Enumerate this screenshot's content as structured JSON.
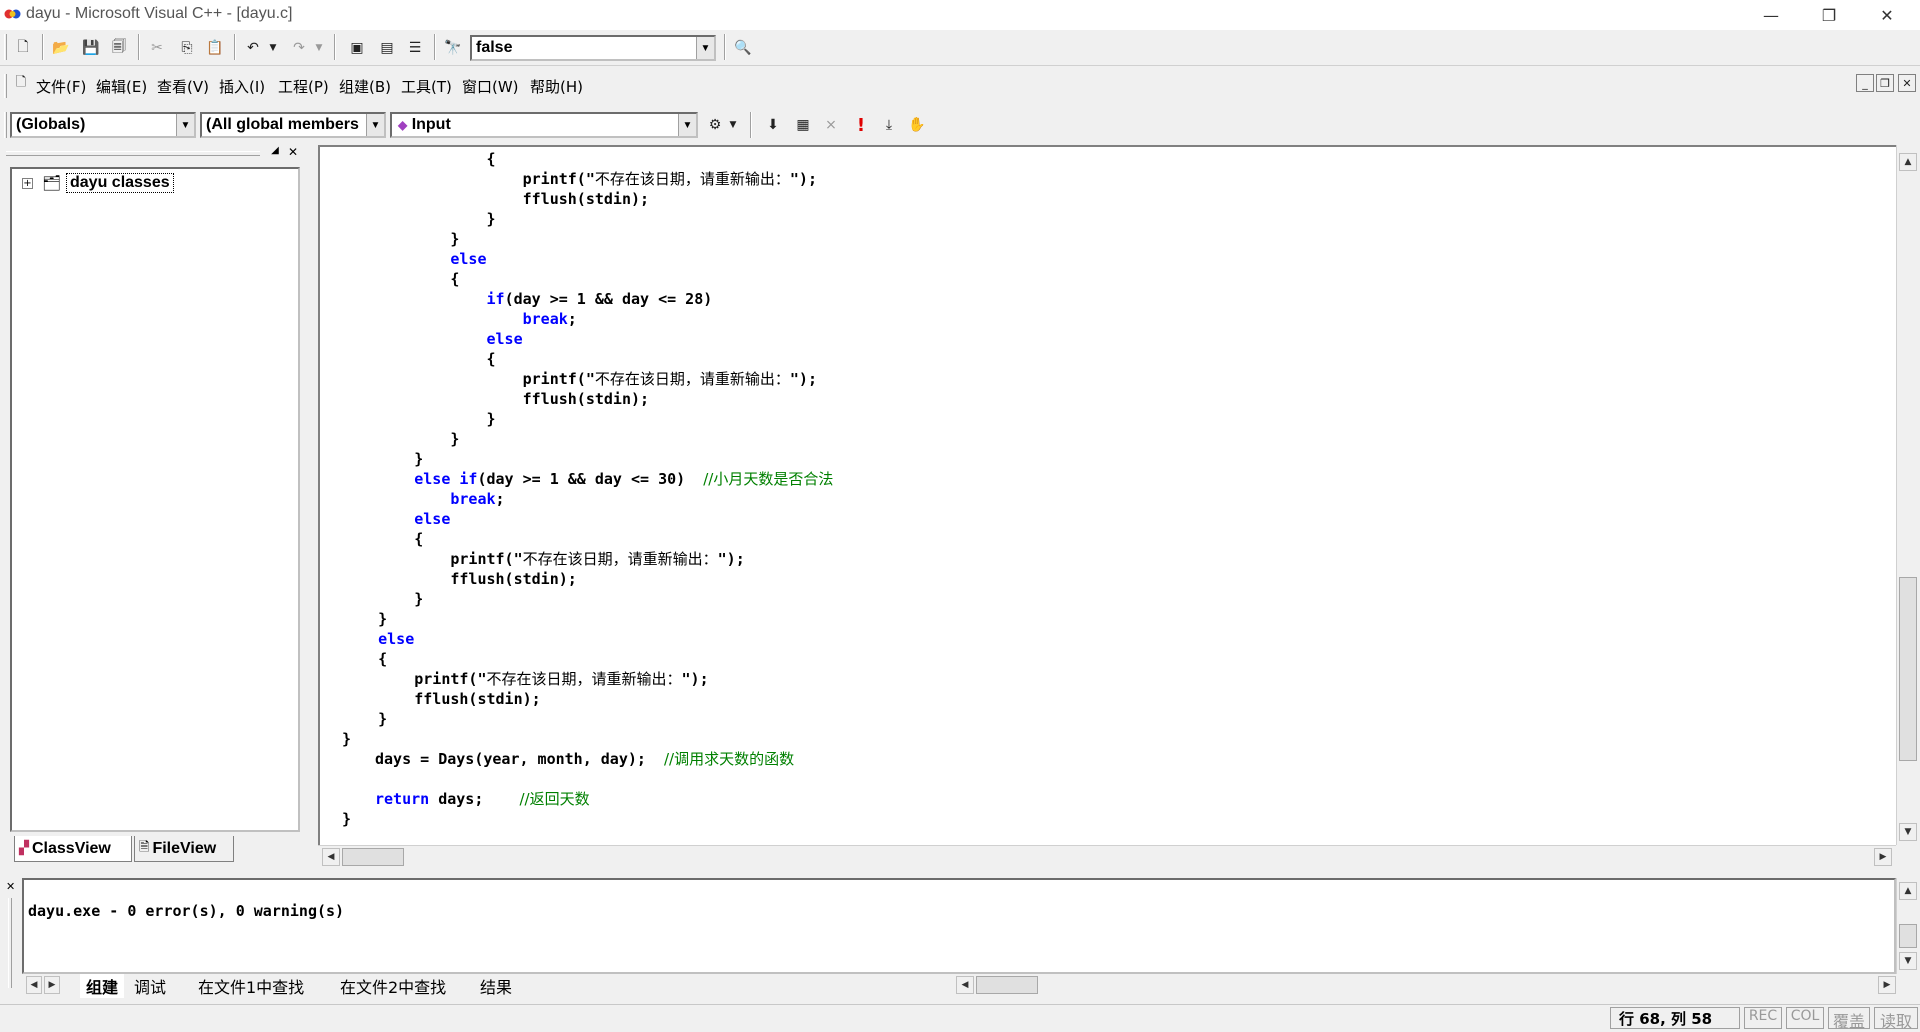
{
  "window": {
    "title": "dayu - Microsoft Visual C++ - [dayu.c]"
  },
  "toolbar": {
    "find_combo_value": "false"
  },
  "menu": {
    "items": [
      "文件(F)",
      "编辑(E)",
      "查看(V)",
      "插入(I)",
      "工程(P)",
      "组建(B)",
      "工具(T)",
      "窗口(W)",
      "帮助(H)"
    ]
  },
  "wizardbar": {
    "class_combo": "(Globals)",
    "filter_combo": "(All global members",
    "members_combo": "Input"
  },
  "workspace": {
    "tree_root": "dayu classes",
    "tabs": [
      "ClassView",
      "FileView"
    ]
  },
  "editor": {
    "lines": [
      "                {",
      "                    printf(\"不存在该日期，请重新输出：\");",
      "                    fflush(stdin);",
      "                }",
      "            }",
      "            else",
      "            {",
      "                if(day >= 1 && day <= 28)",
      "                    break;",
      "                else",
      "                {",
      "                    printf(\"不存在该日期，请重新输出：\");",
      "                    fflush(stdin);",
      "                }",
      "            }",
      "        }",
      "        else if(day >= 1 && day <= 30)  //小月天数是否合法",
      "            break;",
      "        else",
      "        {",
      "            printf(\"不存在该日期，请重新输出：\");",
      "            fflush(stdin);",
      "        }",
      "    }",
      "    else",
      "    {",
      "        printf(\"不存在该日期，请重新输出：\");",
      "        fflush(stdin);",
      "    }",
      "}",
      "days = Days(year, month, day);  //调用求天数的函数",
      "",
      "return days;    //返回天数",
      "}"
    ]
  },
  "output": {
    "message": "dayu.exe - 0 error(s), 0 warning(s)",
    "tabs": [
      "组建",
      "调试",
      "在文件1中查找",
      "在文件2中查找",
      "结果"
    ]
  },
  "statusbar": {
    "position": "行 68, 列 58",
    "rec": "REC",
    "col": "COL",
    "ovr": "覆盖",
    "read": "读取"
  },
  "colors": {
    "keyword": "#0000ff",
    "comment": "#008000",
    "background": "#f0f0f0"
  }
}
